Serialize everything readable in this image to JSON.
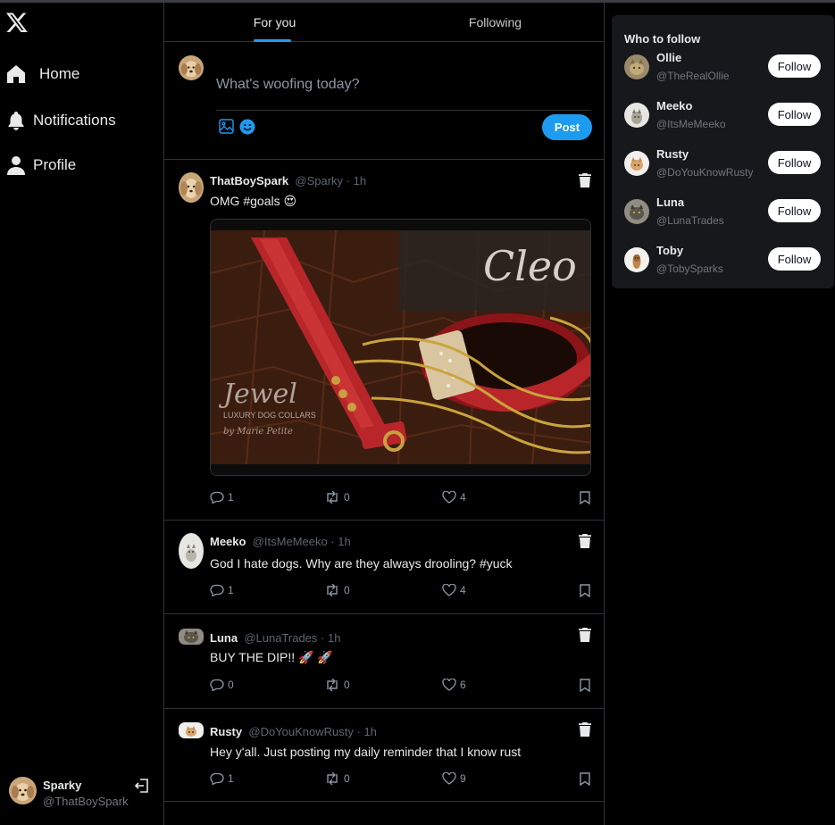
{
  "sidebar": {
    "logo": "x-logo-icon",
    "items": [
      {
        "label": "Home",
        "icon": "home-icon"
      },
      {
        "label": "Notifications",
        "icon": "bell-icon"
      },
      {
        "label": "Profile",
        "icon": "person-icon"
      }
    ],
    "user": {
      "name": "Sparky",
      "handle": "@ThatBoySpark",
      "icon": "logout-icon"
    }
  },
  "tabs": [
    {
      "label": "For you",
      "active": true
    },
    {
      "label": "Following",
      "active": false
    }
  ],
  "composer": {
    "placeholder": "What's woofing today?",
    "post_label": "Post",
    "icons": [
      "image-icon",
      "emoji-icon"
    ]
  },
  "posts": [
    {
      "name": "ThatBoySpark",
      "handle": "@Sparky",
      "time": "1h",
      "text": "OMG #goals 😍",
      "has_image": true,
      "image_texts": {
        "brand": "Cleo",
        "logo": "Jewel",
        "sub": "LUXURY DOG COLLARS",
        "by": "by Marie Petite"
      },
      "replies": "1",
      "reposts": "0",
      "likes": "4"
    },
    {
      "name": "Meeko",
      "handle": "@ItsMeMeeko",
      "time": "1h",
      "text": "God I hate dogs. Why are they always drooling? #yuck",
      "has_image": false,
      "replies": "1",
      "reposts": "0",
      "likes": "4"
    },
    {
      "name": "Luna",
      "handle": "@LunaTrades",
      "time": "1h",
      "text": "BUY THE DIP!! 🚀 🚀",
      "has_image": false,
      "replies": "0",
      "reposts": "0",
      "likes": "6"
    },
    {
      "name": "Rusty",
      "handle": "@DoYouKnowRusty",
      "time": "1h",
      "text": "Hey y'all. Just posting my daily reminder that I know rust",
      "has_image": false,
      "replies": "1",
      "reposts": "0",
      "likes": "9"
    }
  ],
  "who_to_follow": {
    "title": "Who to follow",
    "follow_label": "Follow",
    "users": [
      {
        "name": "Ollie",
        "handle": "@TheRealOllie"
      },
      {
        "name": "Meeko",
        "handle": "@ItsMeMeeko"
      },
      {
        "name": "Rusty",
        "handle": "@DoYouKnowRusty"
      },
      {
        "name": "Luna",
        "handle": "@LunaTrades"
      },
      {
        "name": "Toby",
        "handle": "@TobySparks"
      }
    ]
  },
  "colors": {
    "accent": "#1d9bf0",
    "background": "#000000",
    "border": "#2f3336",
    "muted": "#71767b"
  }
}
